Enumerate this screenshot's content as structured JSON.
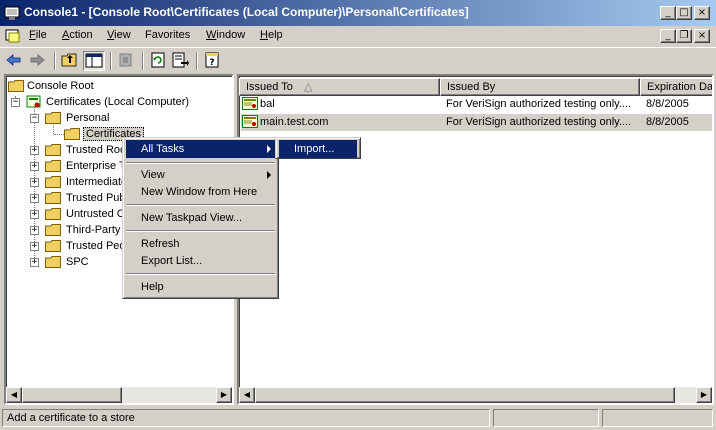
{
  "window": {
    "title": "Console1 - [Console Root\\Certificates (Local Computer)\\Personal\\Certificates]",
    "controls": [
      "_",
      "□",
      "×"
    ],
    "child_controls": [
      "_",
      "❐",
      "×"
    ]
  },
  "menu": [
    {
      "label": "File",
      "accel": "F",
      "rest": "ile"
    },
    {
      "label": "Action",
      "accel": "A",
      "rest": "ction"
    },
    {
      "label": "View",
      "accel": "V",
      "rest": "iew"
    },
    {
      "label": "Favorites",
      "accel": "",
      "rest": "Favorites"
    },
    {
      "label": "Window",
      "accel": "W",
      "rest": "indow"
    },
    {
      "label": "Help",
      "accel": "H",
      "rest": "elp"
    }
  ],
  "tree": {
    "items": [
      {
        "label": "Console Root"
      },
      {
        "label": "Certificates (Local Computer)"
      },
      {
        "label": "Personal"
      },
      {
        "label": "Certificates"
      },
      {
        "label": "Trusted Roo"
      },
      {
        "label": "Enterprise T"
      },
      {
        "label": "Intermediate"
      },
      {
        "label": "Trusted Pub"
      },
      {
        "label": "Untrusted C"
      },
      {
        "label": "Third-Party"
      },
      {
        "label": "Trusted Peo"
      },
      {
        "label": "SPC"
      }
    ]
  },
  "list": {
    "columns": [
      "Issued To",
      "Issued By",
      "Expiration Dat"
    ],
    "sort_indicator": "△",
    "stray_text": "8",
    "rows": [
      {
        "issued_to": "bal",
        "issued_by": "For VeriSign authorized testing only....",
        "expiration": "8/8/2005"
      },
      {
        "issued_to": "main.test.com",
        "issued_by": "For VeriSign authorized testing only....",
        "expiration": "8/8/2005"
      }
    ]
  },
  "context_menu": {
    "items": [
      {
        "label": "All Tasks"
      },
      {
        "label": "View"
      },
      {
        "label": "New Window from Here"
      },
      {
        "label": "New Taskpad View..."
      },
      {
        "label": "Refresh"
      },
      {
        "label": "Export List..."
      },
      {
        "label": "Help"
      }
    ],
    "submenu": [
      {
        "label": "Import..."
      }
    ]
  },
  "status": {
    "text": "Add a certificate to a store"
  },
  "colors": {
    "title_start": "#0a246a",
    "title_end": "#a6caf0",
    "highlight": "#0a246a",
    "face": "#d4d0c8"
  }
}
